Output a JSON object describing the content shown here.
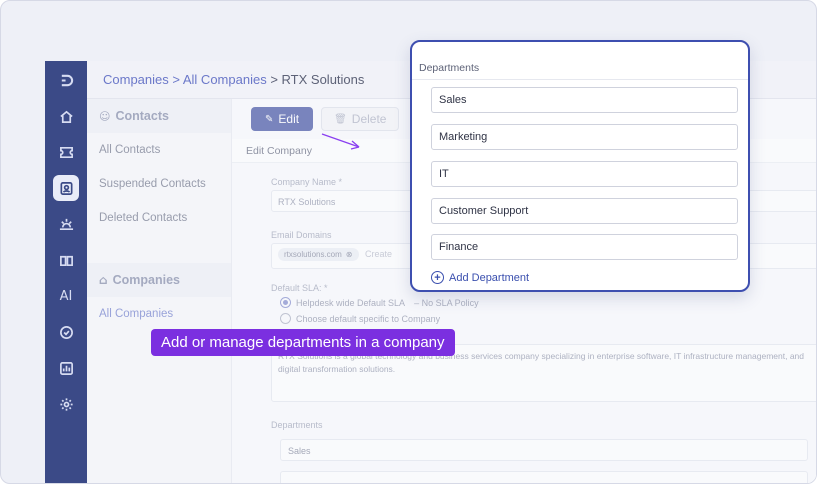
{
  "breadcrumb": {
    "part1": "Companies",
    "sep1": " > ",
    "part2": "All Companies",
    "sep2": " > ",
    "current": "RTX Solutions"
  },
  "sidebar": {
    "contacts_header": "Contacts",
    "contacts_items": [
      "All Contacts",
      "Suspended Contacts",
      "Deleted Contacts"
    ],
    "companies_header": "Companies",
    "companies_items": [
      "All Companies"
    ]
  },
  "rail": {
    "ai_label": "AI"
  },
  "toolbar": {
    "edit_label": "Edit",
    "delete_label": "Delete"
  },
  "subheader": "Edit Company",
  "form": {
    "company_name_label": "Company Name *",
    "company_name_value": "RTX Solutions",
    "email_domains_label": "Email Domains",
    "email_domain_chip": "rtxsolutions.com",
    "email_domain_placeholder": "Create",
    "sla_label": "Default SLA: *",
    "sla_option1": "Helpdesk wide Default SLA",
    "sla_option1_note": "–  No SLA Policy",
    "sla_option2": "Choose default specific to Company",
    "description_value": "RTX Solutions is a global technology and business services company specializing in enterprise software, IT infrastructure management, and digital transformation solutions.",
    "departments_label": "Departments",
    "departments_first": "Sales"
  },
  "popup": {
    "title": "Departments",
    "departments": [
      "Sales",
      "Marketing",
      "IT",
      "Customer Support",
      "Finance"
    ],
    "add_label": "Add Department"
  },
  "tooltip": "Add or manage departments in a company",
  "colors": {
    "rail": "#3b4a87",
    "primary": "#3b4a9e",
    "tooltip": "#7b2fe0",
    "popup_border": "#3e4fb0"
  }
}
